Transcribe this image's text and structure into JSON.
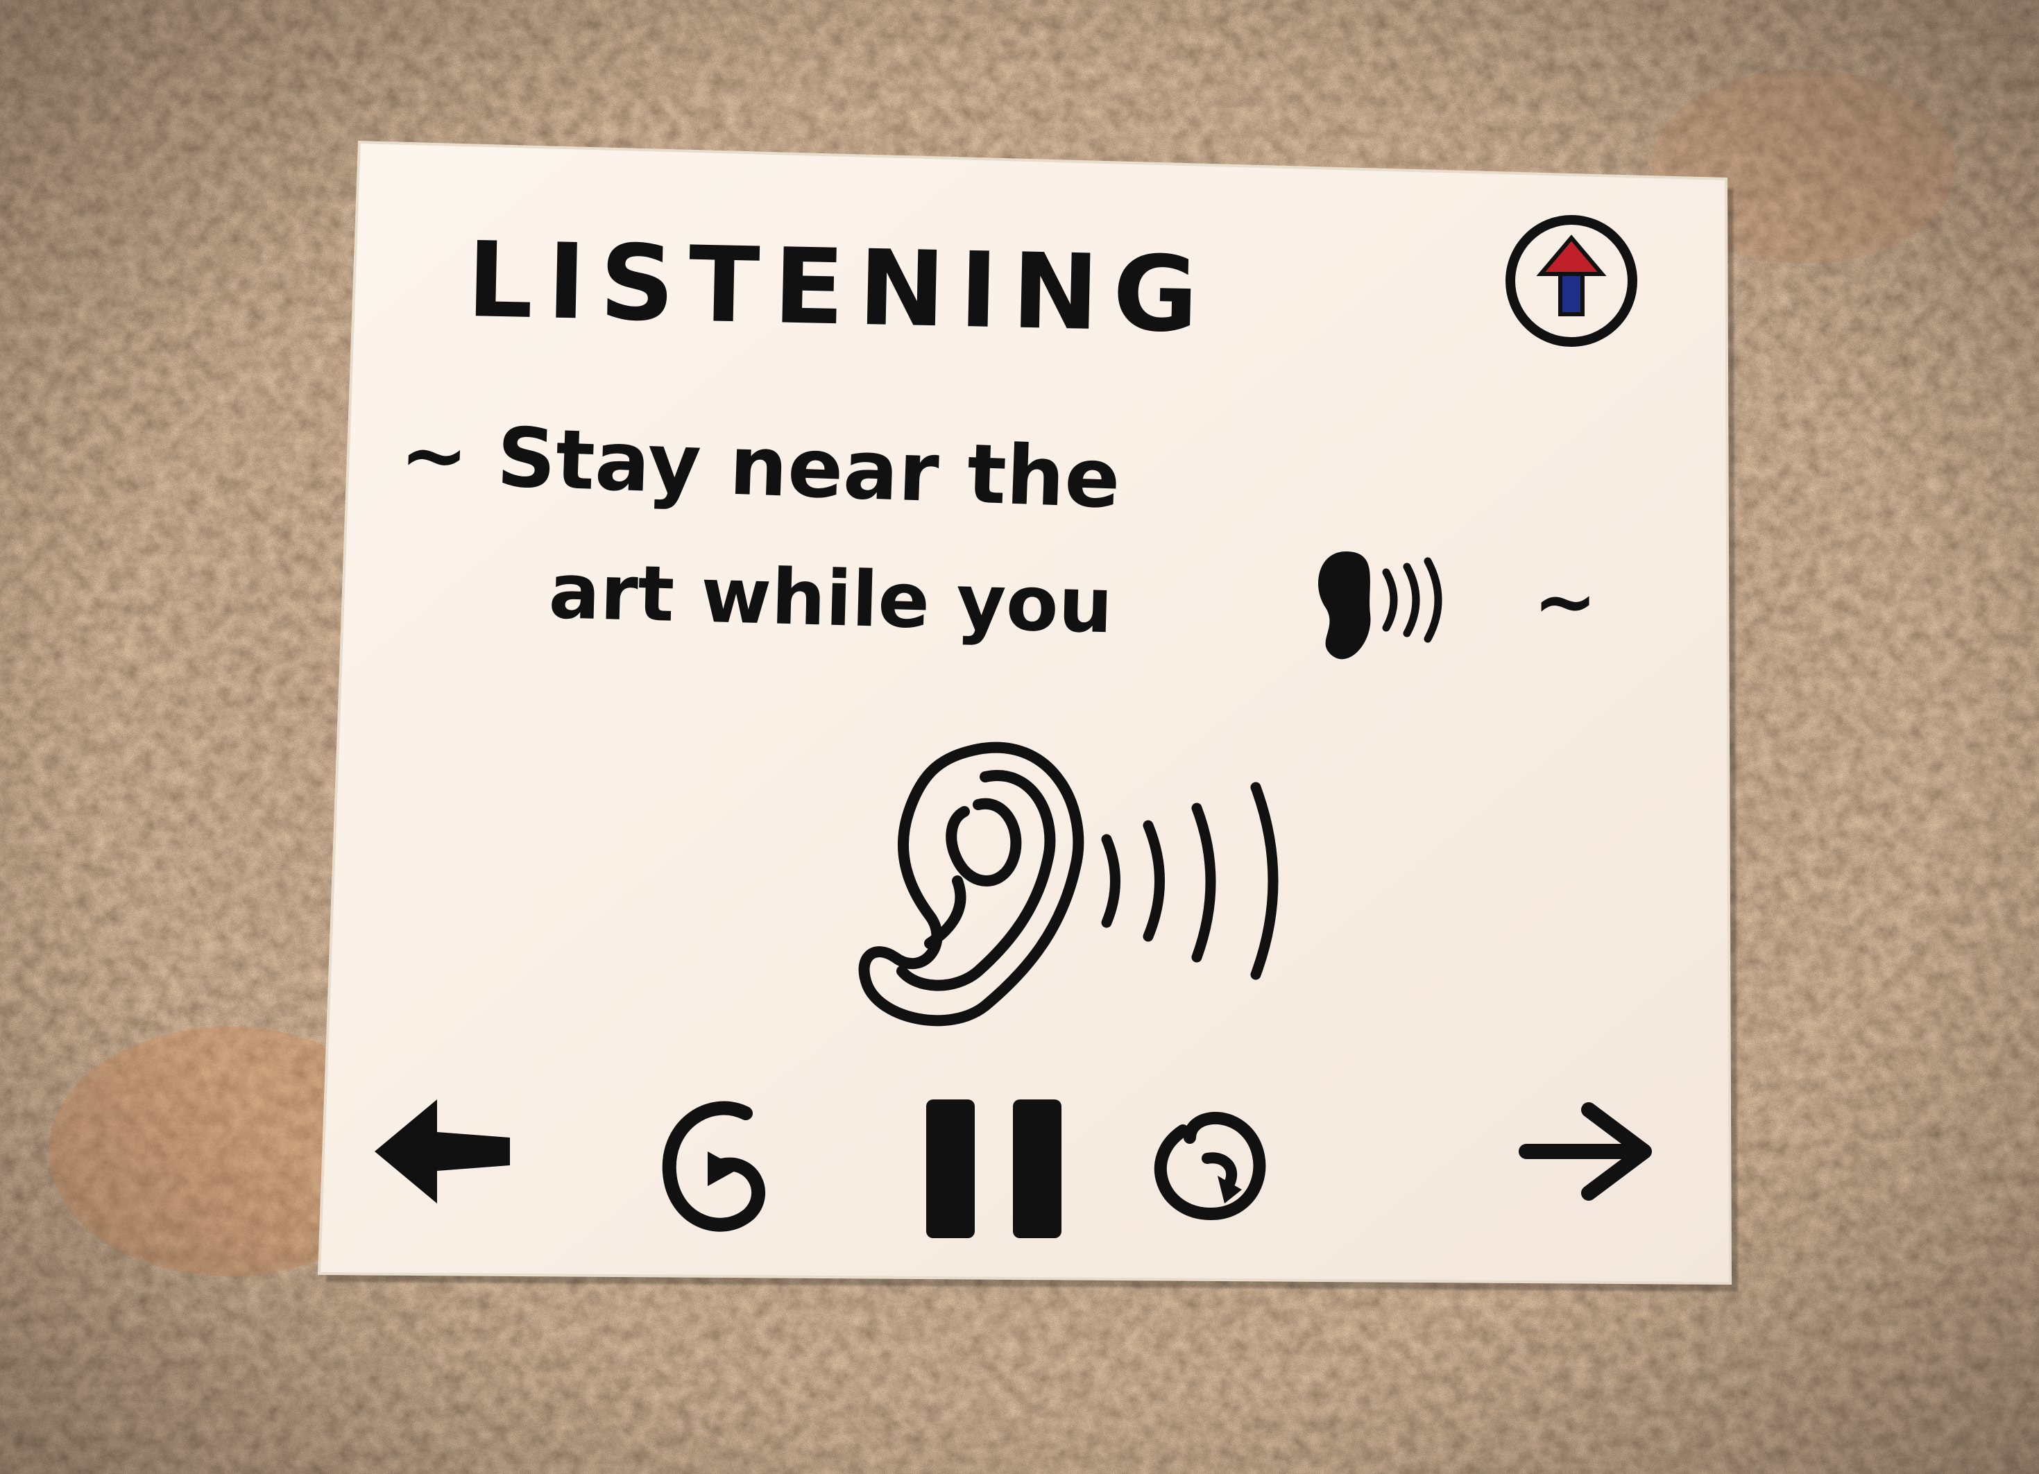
{
  "colors": {
    "paper": "#fbf3ea",
    "ink": "#111111",
    "arrow_red": "#c0202a",
    "arrow_blue": "#1f2f8a",
    "countertop_base": "#8e6a4c"
  },
  "header": {
    "title": "LISTENING",
    "status_icon": "up-arrow-circle-icon"
  },
  "instruction": {
    "line1": "~ Stay near the",
    "line2": "art while you",
    "inline_icon": "listening-ear-icon",
    "trailing": "~"
  },
  "main": {
    "icon": "ear-sound-icon"
  },
  "controls": {
    "previous": "left-arrow-icon",
    "rewind": "rewind-icon",
    "pause": "pause-icon",
    "forward": "forward-icon",
    "next": "right-arrow-icon"
  }
}
